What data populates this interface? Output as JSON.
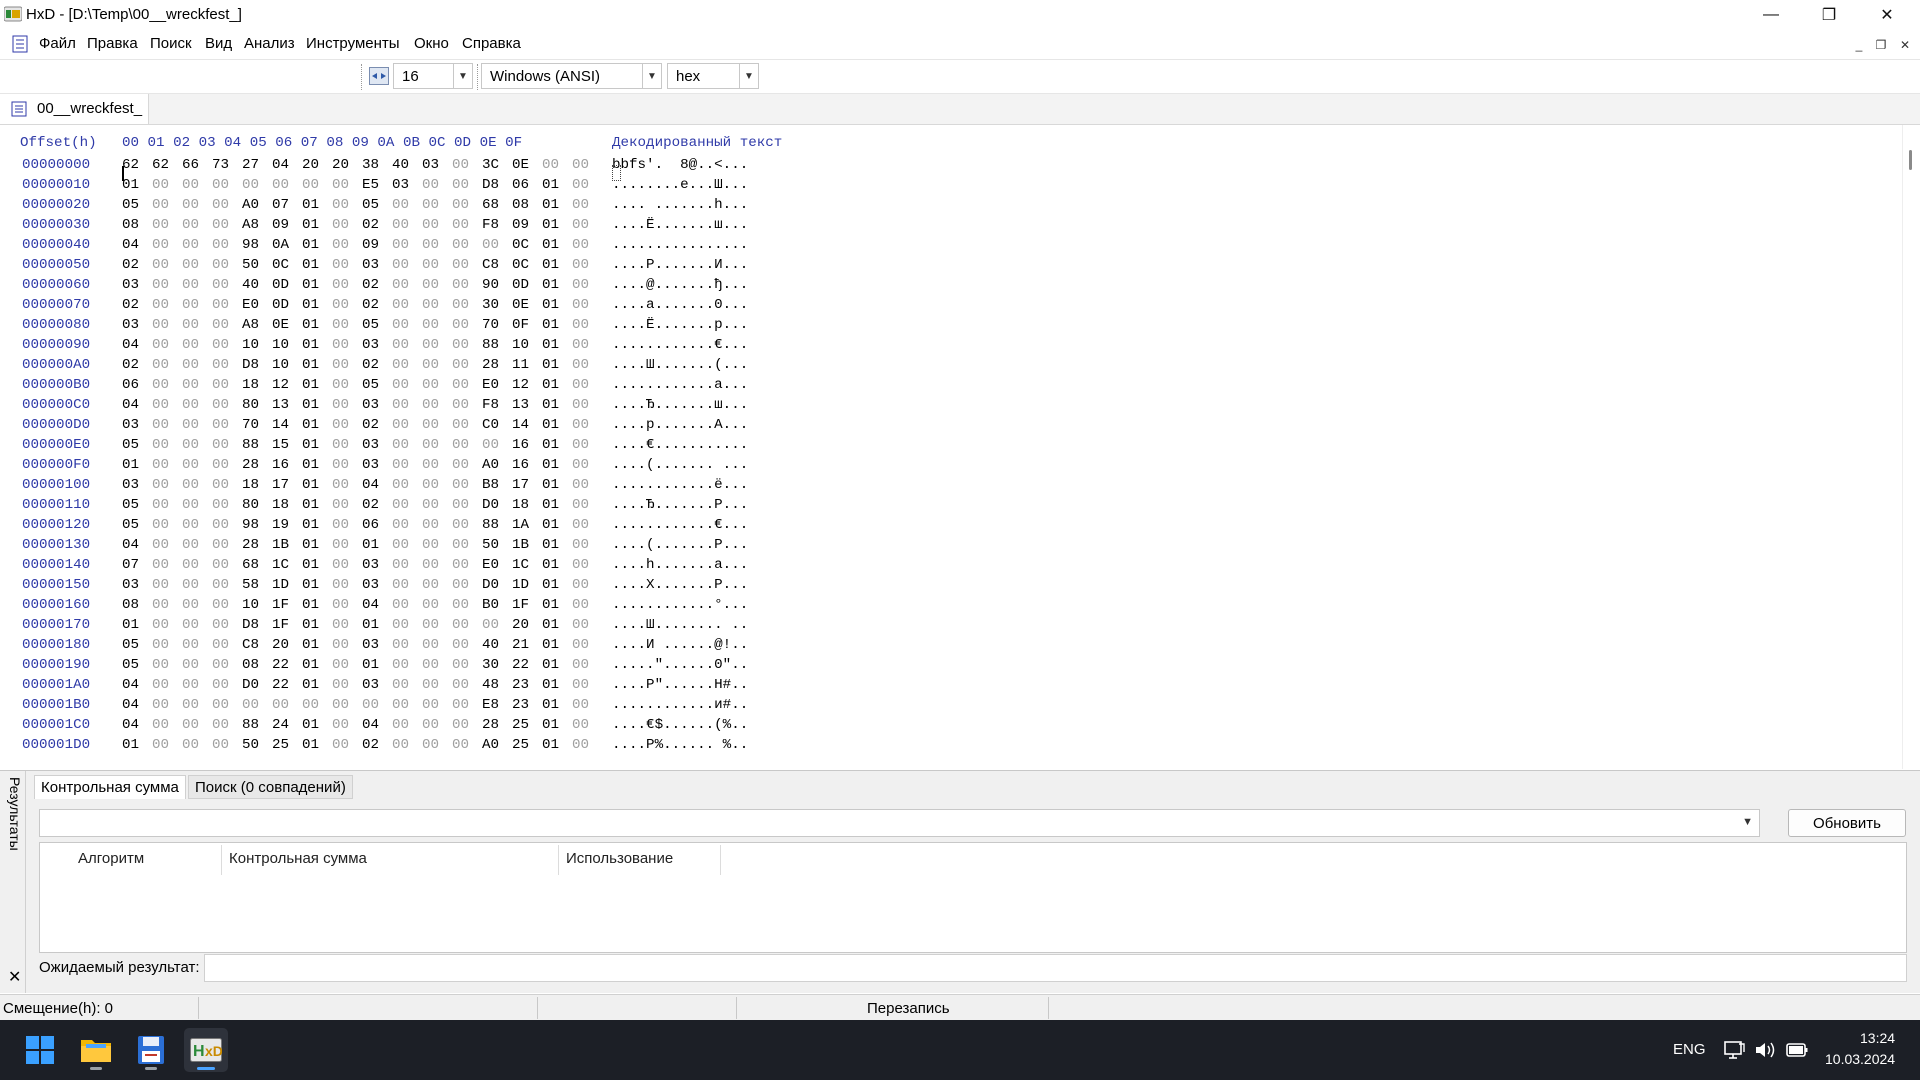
{
  "window": {
    "title": "HxD - [D:\\Temp\\00__wreckfest_]",
    "minimize_glyph": "—",
    "maximize_glyph": "❐",
    "close_glyph": "✕"
  },
  "menu": {
    "items": [
      "Файл",
      "Правка",
      "Поиск",
      "Вид",
      "Анализ",
      "Инструменты",
      "Окно",
      "Справка"
    ],
    "mdi_minimize": "_",
    "mdi_restore": "❐",
    "mdi_close": "✕"
  },
  "toolbar": {
    "bytes_per_row": "16",
    "charset": "Windows (ANSI)",
    "offset_base": "hex"
  },
  "document_tab": {
    "label": "00__wreckfest_"
  },
  "hex": {
    "header": {
      "offset_label": "Offset(h)",
      "columns": "00 01 02 03 04 05 06 07 08 09 0A 0B 0C 0D 0E 0F",
      "text_label": "Декодированный текст"
    },
    "rows": [
      {
        "offset": "00000000",
        "bytes": [
          "62",
          "62",
          "66",
          "73",
          "27",
          "04",
          "20",
          "20",
          "38",
          "40",
          "03",
          "00",
          "3C",
          "0E",
          "00",
          "00"
        ],
        "text": "bbfs'.  8@..<..."
      },
      {
        "offset": "00000010",
        "bytes": [
          "01",
          "00",
          "00",
          "00",
          "00",
          "00",
          "00",
          "00",
          "E5",
          "03",
          "00",
          "00",
          "D8",
          "06",
          "01",
          "00"
        ],
        "text": "........е...Ш..."
      },
      {
        "offset": "00000020",
        "bytes": [
          "05",
          "00",
          "00",
          "00",
          "A0",
          "07",
          "01",
          "00",
          "05",
          "00",
          "00",
          "00",
          "68",
          "08",
          "01",
          "00"
        ],
        "text": ".... .......h..."
      },
      {
        "offset": "00000030",
        "bytes": [
          "08",
          "00",
          "00",
          "00",
          "A8",
          "09",
          "01",
          "00",
          "02",
          "00",
          "00",
          "00",
          "F8",
          "09",
          "01",
          "00"
        ],
        "text": "....Ё.......ш..."
      },
      {
        "offset": "00000040",
        "bytes": [
          "04",
          "00",
          "00",
          "00",
          "98",
          "0A",
          "01",
          "00",
          "09",
          "00",
          "00",
          "00",
          "00",
          "0C",
          "01",
          "00"
        ],
        "text": "................"
      },
      {
        "offset": "00000050",
        "bytes": [
          "02",
          "00",
          "00",
          "00",
          "50",
          "0C",
          "01",
          "00",
          "03",
          "00",
          "00",
          "00",
          "C8",
          "0C",
          "01",
          "00"
        ],
        "text": "....P.......И..."
      },
      {
        "offset": "00000060",
        "bytes": [
          "03",
          "00",
          "00",
          "00",
          "40",
          "0D",
          "01",
          "00",
          "02",
          "00",
          "00",
          "00",
          "90",
          "0D",
          "01",
          "00"
        ],
        "text": "....@.......ђ..."
      },
      {
        "offset": "00000070",
        "bytes": [
          "02",
          "00",
          "00",
          "00",
          "E0",
          "0D",
          "01",
          "00",
          "02",
          "00",
          "00",
          "00",
          "30",
          "0E",
          "01",
          "00"
        ],
        "text": "....а.......0..."
      },
      {
        "offset": "00000080",
        "bytes": [
          "03",
          "00",
          "00",
          "00",
          "A8",
          "0E",
          "01",
          "00",
          "05",
          "00",
          "00",
          "00",
          "70",
          "0F",
          "01",
          "00"
        ],
        "text": "....Ё.......p..."
      },
      {
        "offset": "00000090",
        "bytes": [
          "04",
          "00",
          "00",
          "00",
          "10",
          "10",
          "01",
          "00",
          "03",
          "00",
          "00",
          "00",
          "88",
          "10",
          "01",
          "00"
        ],
        "text": "............€..."
      },
      {
        "offset": "000000A0",
        "bytes": [
          "02",
          "00",
          "00",
          "00",
          "D8",
          "10",
          "01",
          "00",
          "02",
          "00",
          "00",
          "00",
          "28",
          "11",
          "01",
          "00"
        ],
        "text": "....Ш.......(..."
      },
      {
        "offset": "000000B0",
        "bytes": [
          "06",
          "00",
          "00",
          "00",
          "18",
          "12",
          "01",
          "00",
          "05",
          "00",
          "00",
          "00",
          "E0",
          "12",
          "01",
          "00"
        ],
        "text": "............а..."
      },
      {
        "offset": "000000C0",
        "bytes": [
          "04",
          "00",
          "00",
          "00",
          "80",
          "13",
          "01",
          "00",
          "03",
          "00",
          "00",
          "00",
          "F8",
          "13",
          "01",
          "00"
        ],
        "text": "....Ђ.......ш..."
      },
      {
        "offset": "000000D0",
        "bytes": [
          "03",
          "00",
          "00",
          "00",
          "70",
          "14",
          "01",
          "00",
          "02",
          "00",
          "00",
          "00",
          "C0",
          "14",
          "01",
          "00"
        ],
        "text": "....p.......А..."
      },
      {
        "offset": "000000E0",
        "bytes": [
          "05",
          "00",
          "00",
          "00",
          "88",
          "15",
          "01",
          "00",
          "03",
          "00",
          "00",
          "00",
          "00",
          "16",
          "01",
          "00"
        ],
        "text": "....€..........."
      },
      {
        "offset": "000000F0",
        "bytes": [
          "01",
          "00",
          "00",
          "00",
          "28",
          "16",
          "01",
          "00",
          "03",
          "00",
          "00",
          "00",
          "A0",
          "16",
          "01",
          "00"
        ],
        "text": "....(....... ..."
      },
      {
        "offset": "00000100",
        "bytes": [
          "03",
          "00",
          "00",
          "00",
          "18",
          "17",
          "01",
          "00",
          "04",
          "00",
          "00",
          "00",
          "B8",
          "17",
          "01",
          "00"
        ],
        "text": "............ё..."
      },
      {
        "offset": "00000110",
        "bytes": [
          "05",
          "00",
          "00",
          "00",
          "80",
          "18",
          "01",
          "00",
          "02",
          "00",
          "00",
          "00",
          "D0",
          "18",
          "01",
          "00"
        ],
        "text": "....Ђ.......Р..."
      },
      {
        "offset": "00000120",
        "bytes": [
          "05",
          "00",
          "00",
          "00",
          "98",
          "19",
          "01",
          "00",
          "06",
          "00",
          "00",
          "00",
          "88",
          "1A",
          "01",
          "00"
        ],
        "text": "............€..."
      },
      {
        "offset": "00000130",
        "bytes": [
          "04",
          "00",
          "00",
          "00",
          "28",
          "1B",
          "01",
          "00",
          "01",
          "00",
          "00",
          "00",
          "50",
          "1B",
          "01",
          "00"
        ],
        "text": "....(.......P..."
      },
      {
        "offset": "00000140",
        "bytes": [
          "07",
          "00",
          "00",
          "00",
          "68",
          "1C",
          "01",
          "00",
          "03",
          "00",
          "00",
          "00",
          "E0",
          "1C",
          "01",
          "00"
        ],
        "text": "....h.......а..."
      },
      {
        "offset": "00000150",
        "bytes": [
          "03",
          "00",
          "00",
          "00",
          "58",
          "1D",
          "01",
          "00",
          "03",
          "00",
          "00",
          "00",
          "D0",
          "1D",
          "01",
          "00"
        ],
        "text": "....X.......Р..."
      },
      {
        "offset": "00000160",
        "bytes": [
          "08",
          "00",
          "00",
          "00",
          "10",
          "1F",
          "01",
          "00",
          "04",
          "00",
          "00",
          "00",
          "B0",
          "1F",
          "01",
          "00"
        ],
        "text": "............°..."
      },
      {
        "offset": "00000170",
        "bytes": [
          "01",
          "00",
          "00",
          "00",
          "D8",
          "1F",
          "01",
          "00",
          "01",
          "00",
          "00",
          "00",
          "00",
          "20",
          "01",
          "00"
        ],
        "text": "....Ш........ .."
      },
      {
        "offset": "00000180",
        "bytes": [
          "05",
          "00",
          "00",
          "00",
          "C8",
          "20",
          "01",
          "00",
          "03",
          "00",
          "00",
          "00",
          "40",
          "21",
          "01",
          "00"
        ],
        "text": "....И ......@!.."
      },
      {
        "offset": "00000190",
        "bytes": [
          "05",
          "00",
          "00",
          "00",
          "08",
          "22",
          "01",
          "00",
          "01",
          "00",
          "00",
          "00",
          "30",
          "22",
          "01",
          "00"
        ],
        "text": ".....\"......0\".."
      },
      {
        "offset": "000001A0",
        "bytes": [
          "04",
          "00",
          "00",
          "00",
          "D0",
          "22",
          "01",
          "00",
          "03",
          "00",
          "00",
          "00",
          "48",
          "23",
          "01",
          "00"
        ],
        "text": "....Р\"......H#.."
      },
      {
        "offset": "000001B0",
        "bytes": [
          "04",
          "00",
          "00",
          "00",
          "00",
          "00",
          "00",
          "00",
          "00",
          "00",
          "00",
          "00",
          "E8",
          "23",
          "01",
          "00"
        ],
        "text": "............и#.."
      },
      {
        "offset": "000001C0",
        "bytes": [
          "04",
          "00",
          "00",
          "00",
          "88",
          "24",
          "01",
          "00",
          "04",
          "00",
          "00",
          "00",
          "28",
          "25",
          "01",
          "00"
        ],
        "text": "....€$......(%.."
      },
      {
        "offset": "000001D0",
        "bytes": [
          "01",
          "00",
          "00",
          "00",
          "50",
          "25",
          "01",
          "00",
          "02",
          "00",
          "00",
          "00",
          "A0",
          "25",
          "01",
          "00"
        ],
        "text": "....P%...... %.."
      }
    ]
  },
  "results": {
    "side_label": "Результаты",
    "close_glyph": "✕",
    "tabs": [
      "Контрольная сумма",
      "Поиск (0 совпадений)"
    ],
    "refresh_label": "Обновить",
    "table_headers": [
      "Алгоритм",
      "Контрольная сумма",
      "Использование"
    ],
    "expected_label": "Ожидаемый результат:"
  },
  "status": {
    "offset": "Смещение(h): 0",
    "mode": "Перезапись"
  },
  "taskbar": {
    "lang": "ENG",
    "time": "13:24",
    "date": "10.03.2024"
  },
  "colors": {
    "offset_blue": "#2f3aa8",
    "zero_byte_gray": "#a0a0a0",
    "taskbar_bg": "#1c1f26",
    "windows_blue": "#1e90ff"
  }
}
